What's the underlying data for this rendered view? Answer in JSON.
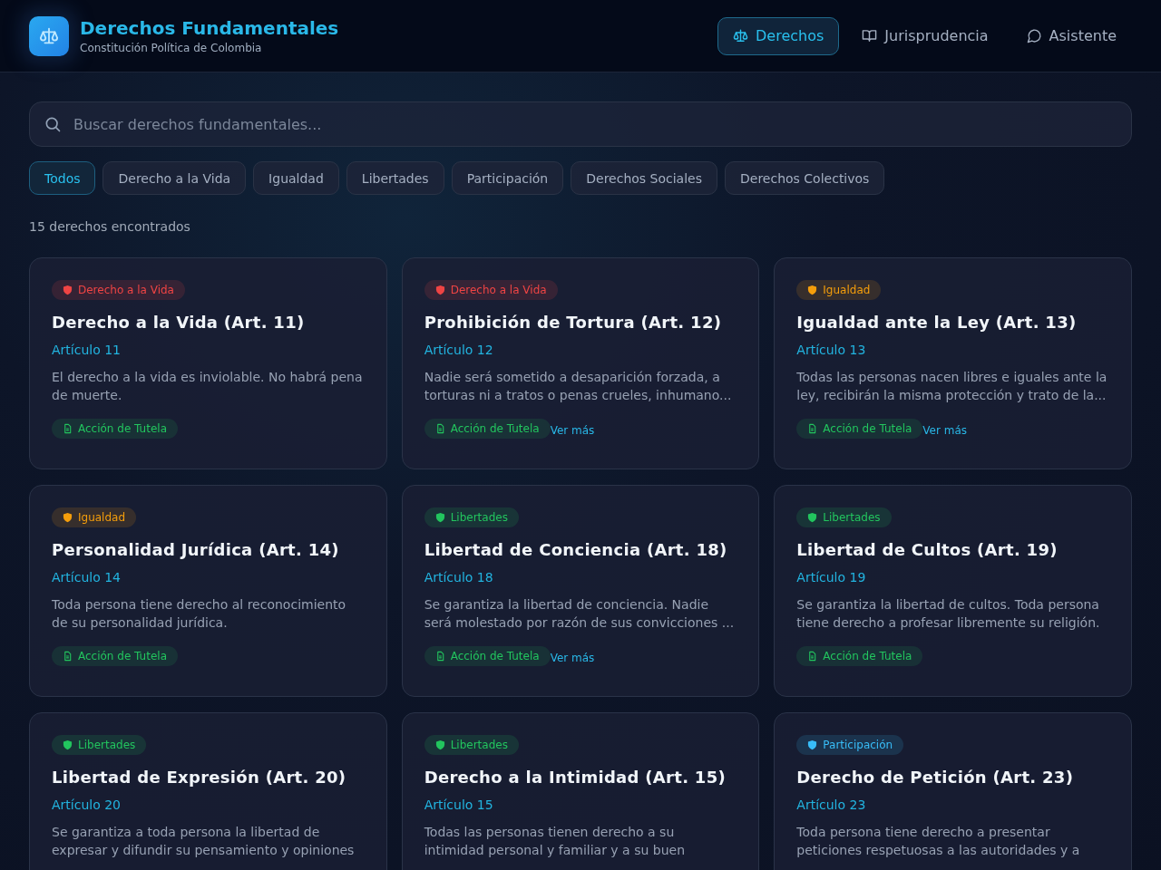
{
  "header": {
    "title": "Derechos Fundamentales",
    "subtitle": "Constitución Política de Colombia"
  },
  "nav": [
    {
      "label": "Derechos",
      "kind": "scales",
      "selected": true
    },
    {
      "label": "Jurisprudencia",
      "kind": "book",
      "selected": false
    },
    {
      "label": "Asistente",
      "kind": "chat",
      "selected": false
    }
  ],
  "search": {
    "placeholder": "Buscar derechos fundamentales..."
  },
  "filters": [
    {
      "label": "Todos",
      "selected": true
    },
    {
      "label": "Derecho a la Vida",
      "selected": false
    },
    {
      "label": "Igualdad",
      "selected": false
    },
    {
      "label": "Libertades",
      "selected": false
    },
    {
      "label": "Participación",
      "selected": false
    },
    {
      "label": "Derechos Sociales",
      "selected": false
    },
    {
      "label": "Derechos Colectivos",
      "selected": false
    }
  ],
  "result_count": "15 derechos encontrados",
  "cards": [
    {
      "category": {
        "label": "Derecho a la Vida",
        "color": "#ef4444"
      },
      "title": "Derecho a la Vida (Art. 11)",
      "article": "Artículo 11",
      "description": "El derecho a la vida es inviolable. No habrá pena de muerte.",
      "tutela": "Acción de Tutela"
    },
    {
      "category": {
        "label": "Derecho a la Vida",
        "color": "#ef4444"
      },
      "title": "Prohibición de Tortura (Art. 12)",
      "article": "Artículo 12",
      "description": "Nadie será sometido a desaparición forzada, a torturas ni a tratos o penas crueles, inhumano...",
      "tutela": "Acción de Tutela",
      "more_link": "Ver más"
    },
    {
      "category": {
        "label": "Igualdad",
        "color": "#f59e0b"
      },
      "title": "Igualdad ante la Ley (Art. 13)",
      "article": "Artículo 13",
      "description": "Todas las personas nacen libres e iguales ante la ley, recibirán la misma protección y trato de la...",
      "tutela": "Acción de Tutela",
      "more_link": "Ver más"
    },
    {
      "category": {
        "label": "Igualdad",
        "color": "#f59e0b"
      },
      "title": "Personalidad Jurídica (Art. 14)",
      "article": "Artículo 14",
      "description": "Toda persona tiene derecho al reconocimiento de su personalidad jurídica.",
      "tutela": "Acción de Tutela"
    },
    {
      "category": {
        "label": "Libertades",
        "color": "#22c55e"
      },
      "title": "Libertad de Conciencia (Art. 18)",
      "article": "Artículo 18",
      "description": "Se garantiza la libertad de conciencia. Nadie será molestado por razón de sus convicciones ...",
      "tutela": "Acción de Tutela",
      "more_link": "Ver más"
    },
    {
      "category": {
        "label": "Libertades",
        "color": "#22c55e"
      },
      "title": "Libertad de Cultos (Art. 19)",
      "article": "Artículo 19",
      "description": "Se garantiza la libertad de cultos. Toda persona tiene derecho a profesar libremente su religión.",
      "tutela": "Acción de Tutela"
    },
    {
      "category": {
        "label": "Libertades",
        "color": "#22c55e"
      },
      "title": "Libertad de Expresión (Art. 20)",
      "article": "Artículo 20",
      "description": "Se garantiza a toda persona la libertad de expresar y difundir su pensamiento y opiniones"
    },
    {
      "category": {
        "label": "Libertades",
        "color": "#22c55e"
      },
      "title": "Derecho a la Intimidad (Art. 15)",
      "article": "Artículo 15",
      "description": "Todas las personas tienen derecho a su intimidad personal y familiar y a su buen"
    },
    {
      "category": {
        "label": "Participación",
        "color": "#38bdf8"
      },
      "title": "Derecho de Petición (Art. 23)",
      "article": "Artículo 23",
      "description": "Toda persona tiene derecho a presentar peticiones respetuosas a las autoridades y a"
    }
  ]
}
